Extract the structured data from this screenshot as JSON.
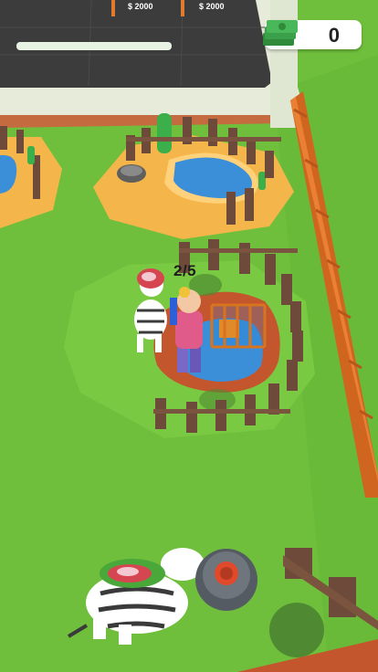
{
  "hud": {
    "money_value": "0",
    "money_icon": "cash-stack-icon"
  },
  "build_plots": {
    "price_left": "$ 2000",
    "price_right": "$ 2000"
  },
  "enclosure": {
    "capacity_label": "2/5"
  },
  "colors": {
    "grass": "#6fbf3c",
    "dirt": "#c4562e",
    "water": "#3a8fd8",
    "fence_wood": "#6e4a3a",
    "sand": "#f4b64a",
    "asphalt": "#3d3d3d"
  }
}
